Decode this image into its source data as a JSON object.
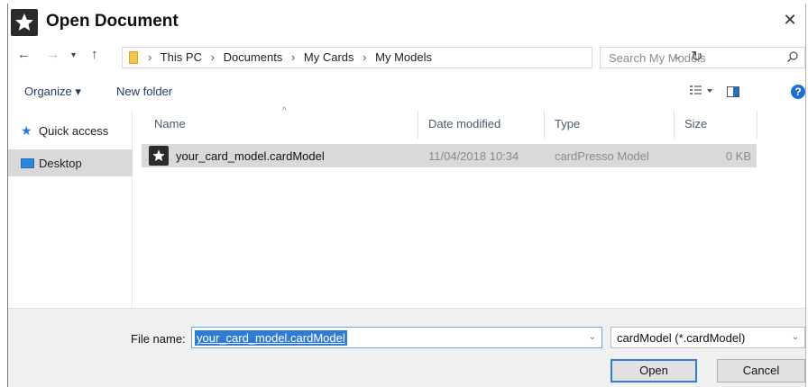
{
  "window": {
    "title": "Open Document"
  },
  "address": {
    "crumbs": [
      "This PC",
      "Documents",
      "My Cards",
      "My Models"
    ]
  },
  "search": {
    "placeholder": "Search My Models"
  },
  "toolbar": {
    "organize": "Organize ▾",
    "new_folder": "New folder"
  },
  "navpane": {
    "items": [
      {
        "label": "Quick access",
        "icon": "star-icon"
      },
      {
        "label": "Desktop",
        "icon": "desktop-icon",
        "selected": true
      }
    ]
  },
  "columns": {
    "name": "Name",
    "date": "Date modified",
    "type": "Type",
    "size": "Size"
  },
  "files": [
    {
      "name": "your_card_model.cardModel",
      "date": "11/04/2018 10:34",
      "type": "cardPresso Model",
      "size": "0 KB"
    }
  ],
  "filename": {
    "label": "File name:",
    "value": "your_card_model.cardModel"
  },
  "filetype": {
    "value": "cardModel (*.cardModel)"
  },
  "buttons": {
    "open": "Open",
    "cancel": "Cancel"
  },
  "colors": {
    "accent": "#2f7bd6",
    "selection": "#d9d9d9"
  }
}
